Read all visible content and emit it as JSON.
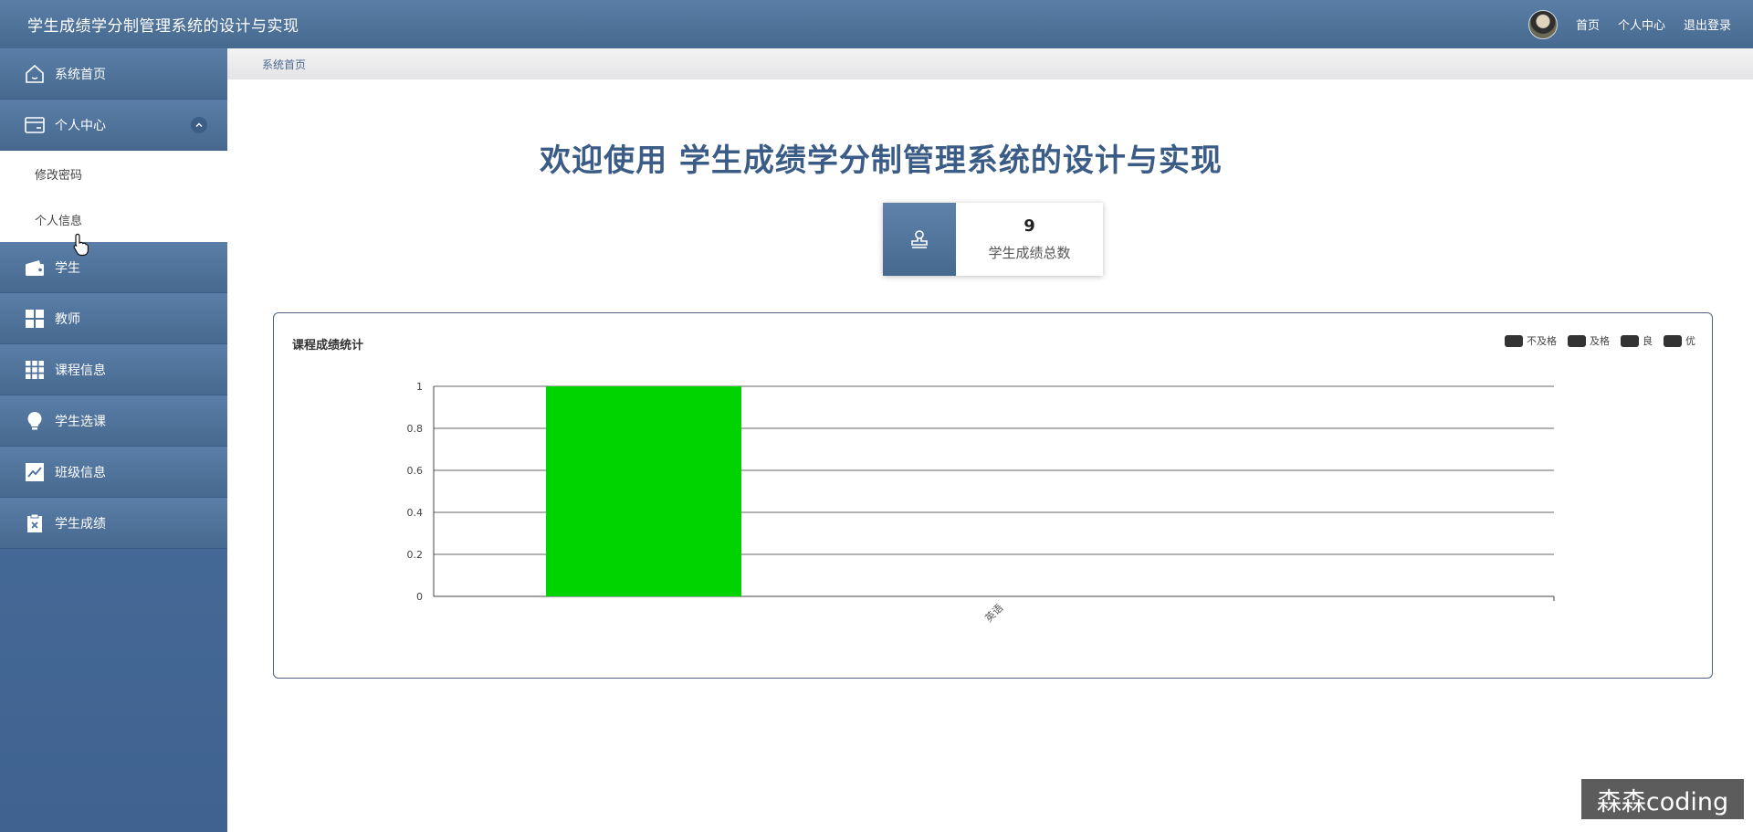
{
  "header": {
    "app_title": "学生成绩学分制管理系统的设计与实现",
    "links": {
      "home": "首页",
      "profile": "个人中心",
      "logout": "退出登录"
    }
  },
  "sidebar": {
    "items": [
      {
        "label": "系统首页",
        "icon": "home-icon"
      },
      {
        "label": "个人中心",
        "icon": "card-icon",
        "expanded": true,
        "children": [
          {
            "label": "修改密码"
          },
          {
            "label": "个人信息"
          }
        ]
      },
      {
        "label": "学生",
        "icon": "wallet-icon"
      },
      {
        "label": "教师",
        "icon": "grid-icon"
      },
      {
        "label": "课程信息",
        "icon": "apps-icon"
      },
      {
        "label": "学生选课",
        "icon": "bulb-icon"
      },
      {
        "label": "班级信息",
        "icon": "chart-line-icon"
      },
      {
        "label": "学生成绩",
        "icon": "clipboard-icon"
      }
    ]
  },
  "breadcrumb": {
    "current": "系统首页"
  },
  "main": {
    "welcome": "欢迎使用 学生成绩学分制管理系统的设计与实现",
    "stat": {
      "value": "9",
      "label": "学生成绩总数",
      "icon": "stamp-icon"
    }
  },
  "chart_data": {
    "type": "bar",
    "title": "课程成绩统计",
    "categories": [
      "英语"
    ],
    "series": [
      {
        "name": "不及格",
        "values": [
          0
        ]
      },
      {
        "name": "及格",
        "values": [
          1
        ]
      },
      {
        "name": "良",
        "values": [
          0
        ]
      },
      {
        "name": "优",
        "values": [
          0
        ]
      }
    ],
    "ylim": [
      0,
      1
    ],
    "yticks": [
      "0",
      "0.2",
      "0.4",
      "0.6",
      "0.8",
      "1"
    ],
    "grid": true,
    "legend": "top-right",
    "bar_color": "#00d400"
  },
  "watermark": "森森coding"
}
